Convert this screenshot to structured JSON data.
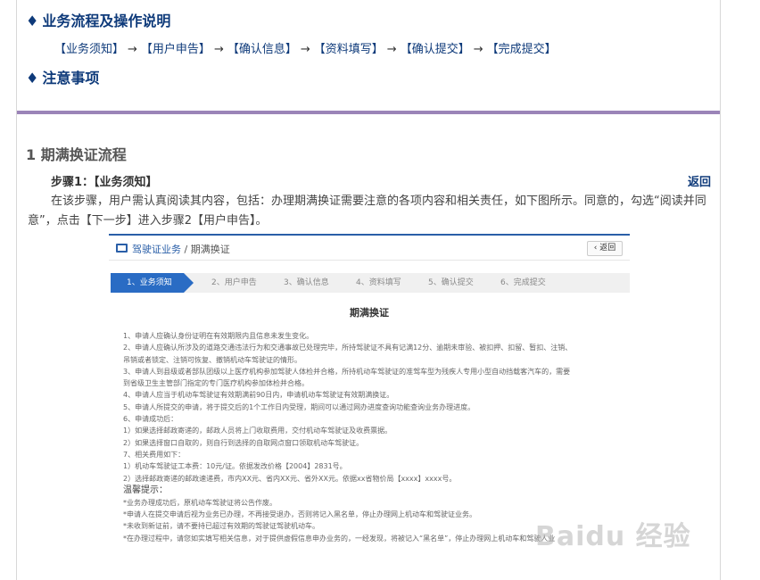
{
  "sections": {
    "process_title": "业务流程及操作说明",
    "notes_title": "注意事项",
    "diamond": "♦"
  },
  "flow_steps": [
    "【业务须知】",
    "【用户申告】",
    "【确认信息】",
    "【资料填写】",
    "【确认提交】",
    "【完成提交】"
  ],
  "flow_arrow": "→",
  "main": {
    "heading": "1 期满换证流程",
    "step_title": "步骤1：【业务须知】",
    "back_label": "返回",
    "description": "在该步骤，用户需认真阅读其内容，包括：办理期满换证需要注意的各项内容和相关责任，如下图所示。同意的，勾选“阅读并同意”，点击【下一步】进入步骤2【用户申告】。"
  },
  "screenshot": {
    "breadcrumb_main": "驾驶证业务",
    "breadcrumb_sep": " / ",
    "breadcrumb_sub": "期满换证",
    "back_label": "‹ 返回",
    "wizard_steps": [
      "1、业务须知",
      "2、用户申告",
      "3、确认信息",
      "4、资料填写",
      "5、确认提交",
      "6、完成提交"
    ],
    "doc_title": "期满换证",
    "doc_lines": [
      "1、申请人应确认身份证明在有效期限内且信息未发生变化。",
      "2、申请人应确认所涉及的道路交通违法行为和交通事故已处理完毕，所持驾驶证不具有记满12分、逾期未审验、被扣押、扣留、暂扣、注销、",
      "吊销或者锁定、注销可恢复、撤销机动车驾驶证的情形。",
      "3、申请人到县级或者部队团级以上医疗机构参加驾驶人体检并合格，所持机动车驾驶证的准驾车型为残疾人专用小型自动挡载客汽车的，需要",
      "到省级卫生主管部门指定的专门医疗机构参加体检并合格。",
      "4、申请人应当于机动车驾驶证有效期满前90日内，申请机动车驾驶证有效期满换证。",
      "5、申请人所提交的申请，将于提交后的1个工作日内受理，期间可以通过网办进度查询功能查询业务办理进度。",
      "6、申请成功后：",
      "1）如果选择邮政寄递的，邮政人员将上门收取费用，交付机动车驾驶证及收费票据。",
      "2）如果选择窗口自取的，则自行到选择的自取网点窗口领取机动车驾驶证。",
      "7、相关费用如下：",
      "1）机动车驾驶证工本费：10元/证。依据发改价格【2004】2831号。",
      "2）选择邮政寄递的邮政速递费，市内XX元、省内XX元、省外XX元。依据xx省物价局【xxxx】xxxx号。"
    ],
    "warm_title": "温馨提示：",
    "warm_lines": [
      "*业务办理成功后，原机动车驾驶证将公告作废。",
      "*申请人在提交申请后视为业务已办理，不再接受退办，否则将记入黑名单，停止办理网上机动车和驾驶证业务。",
      "*未收到新证前，请不要持已超过有效期的驾驶证驾驶机动车。",
      "*在办理过程中，请您如实填写相关信息，对于提供虚假信息申办业务的，一经发现，将被记入“黑名单”，停止办理网上机动车和驾驶人业"
    ]
  },
  "watermark": "Baidu 经验"
}
